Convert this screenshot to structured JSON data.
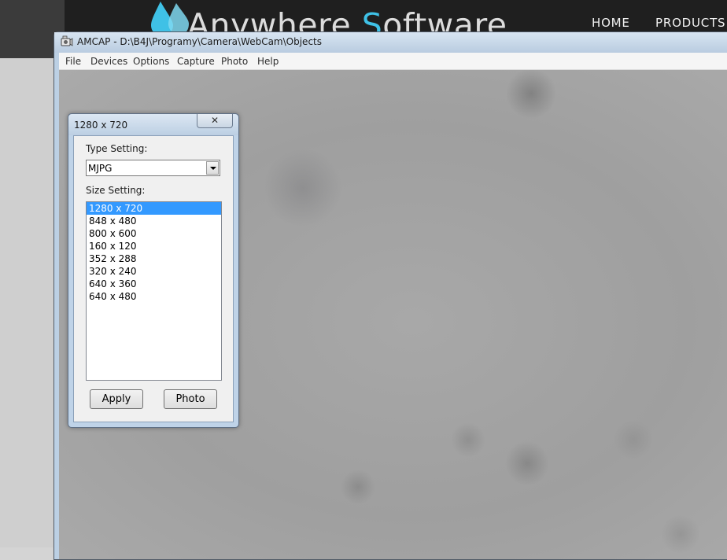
{
  "website": {
    "logo_prefix": "Anywhere ",
    "logo_s": "S",
    "logo_suffix": "oftware",
    "nav": [
      "HOME",
      "PRODUCTS"
    ],
    "colors": {
      "header": "#1f1f1f",
      "accent": "#3fc1e6"
    }
  },
  "amcap": {
    "title": "AMCAP - D:\\B4J\\Programy\\Camera\\WebCam\\Objects",
    "icon": "webcam-app-icon",
    "menu": [
      "File",
      "Devices",
      "Options",
      "Capture",
      "Photo",
      "Help"
    ]
  },
  "dialog": {
    "title": "1280 x 720",
    "close_label": "✕",
    "type_label": "Type Setting:",
    "type_value": "MJPG",
    "size_label": "Size Setting:",
    "sizes": [
      "1280 x 720",
      "848 x 480",
      "800 x 600",
      "160 x 120",
      "352 x 288",
      "320 x 240",
      "640 x 360",
      "640 x 480"
    ],
    "selected_index": 0,
    "apply_label": "Apply",
    "photo_label": "Photo",
    "selection_color": "#3399ff"
  }
}
